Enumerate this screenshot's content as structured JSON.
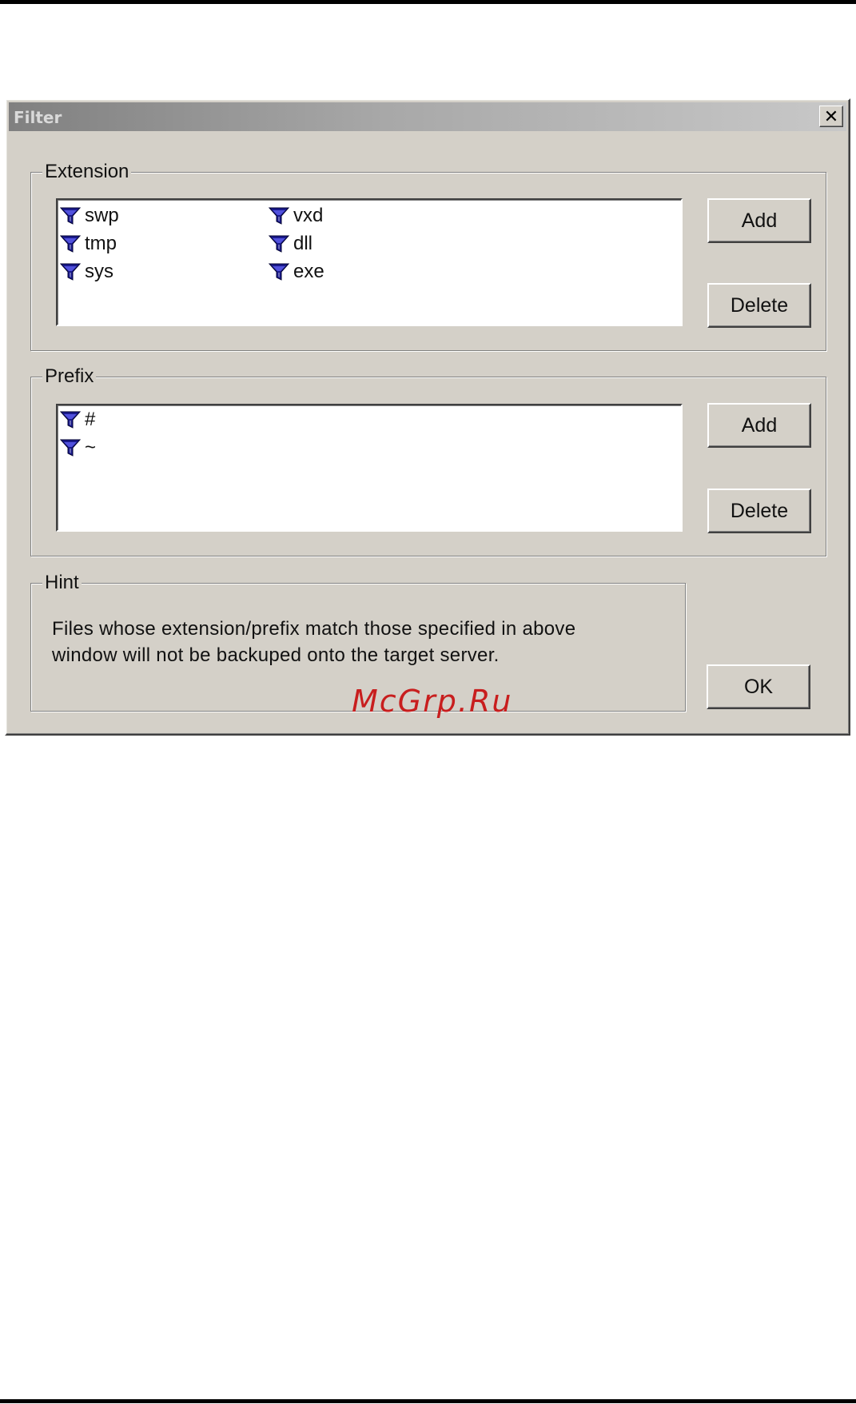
{
  "window": {
    "title": "Filter",
    "close_glyph": "✕"
  },
  "extension": {
    "group_label": "Extension",
    "items": [
      "swp",
      "tmp",
      "sys",
      "vxd",
      "dll",
      "exe"
    ],
    "add_label": "Add",
    "delete_label": "Delete"
  },
  "prefix": {
    "group_label": "Prefix",
    "items": [
      "#",
      "~"
    ],
    "add_label": "Add",
    "delete_label": "Delete"
  },
  "hint": {
    "group_label": "Hint",
    "line1": "Files whose extension/prefix match those specified in above",
    "line2": "window will not be backuped onto the target server."
  },
  "ok_label": "OK",
  "watermark": "McGrp.Ru",
  "icons": {
    "list_item_icon": "filter-funnel-icon"
  },
  "colors": {
    "funnel_fill": "#1a1a8c",
    "funnel_highlight": "#6a6aff",
    "titlebar_start": "#808080",
    "face": "#d4d0c8"
  }
}
